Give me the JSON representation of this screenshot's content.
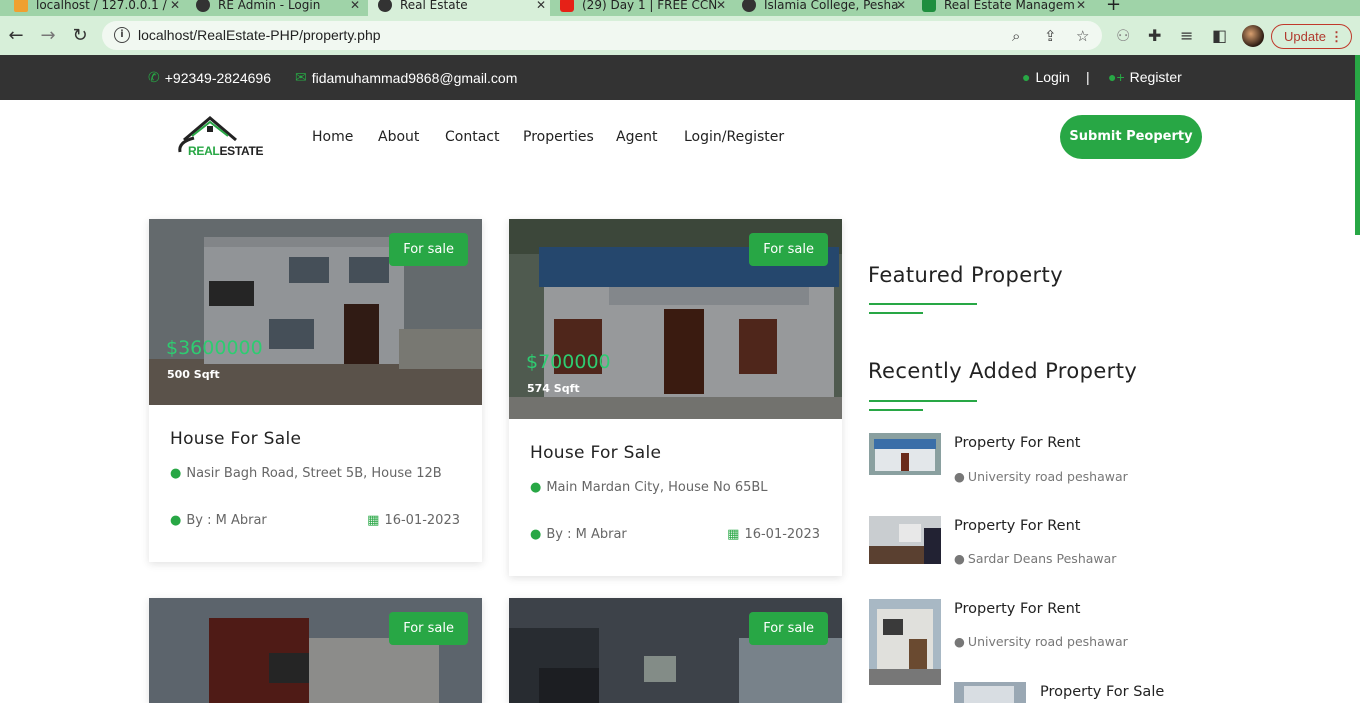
{
  "browser": {
    "tabs": [
      {
        "title": "localhost / 127.0.0.1 /",
        "active": false
      },
      {
        "title": "RE Admin - Login",
        "active": false
      },
      {
        "title": "Real Estate",
        "active": true
      },
      {
        "title": "(29) Day 1 | FREE CCN",
        "active": false
      },
      {
        "title": "Islamia College, Pesha",
        "active": false
      },
      {
        "title": "Real Estate Managem",
        "active": false
      }
    ],
    "url": "localhost/RealEstate-PHP/property.php",
    "update_label": "Update"
  },
  "topbar": {
    "phone": "+92349-2824696",
    "email": "fidamuhammad9868@gmail.com",
    "login": "Login",
    "separator": "|",
    "register": "Register"
  },
  "header": {
    "logo": {
      "part1": "REAL",
      "part2": "ESTATE"
    },
    "menu": [
      "Home",
      "About",
      "Contact",
      "Properties",
      "Agent",
      "Login/Register"
    ],
    "submit_label": "Submit Peoperty"
  },
  "properties": [
    {
      "badge": "For sale",
      "price": "$3600000",
      "area": "500 Sqft",
      "title": "House For Sale",
      "address": "Nasir Bagh Road, Street 5B, House 12B",
      "by": "By : M Abrar",
      "date": "16-01-2023"
    },
    {
      "badge": "For sale",
      "price": "$700000",
      "area": "574 Sqft",
      "title": "House For Sale",
      "address": "Main Mardan City, House No 65BL",
      "by": "By : M Abrar",
      "date": "16-01-2023"
    },
    {
      "badge": "For sale"
    },
    {
      "badge": "For sale"
    }
  ],
  "sidebar": {
    "featured_title": "Featured Property",
    "recent_title": "Recently Added Property",
    "recent": [
      {
        "title": "Property For Rent",
        "location": "University road peshawar"
      },
      {
        "title": "Property For Rent",
        "location": "Sardar Deans Peshawar"
      },
      {
        "title": "Property For Rent",
        "location": "University road peshawar"
      },
      {
        "title": "Property For Sale"
      }
    ]
  },
  "colors": {
    "accent": "#28a745",
    "topbar_bg": "#333333",
    "price": "#2ecc71"
  }
}
